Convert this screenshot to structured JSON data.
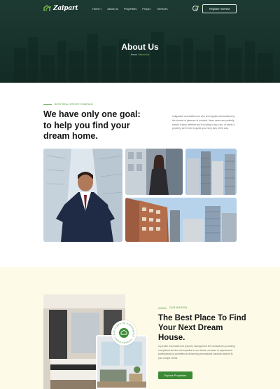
{
  "brand": {
    "name": "Zaipart"
  },
  "nav": [
    {
      "label": "Home",
      "has_dropdown": true
    },
    {
      "label": "About us",
      "has_dropdown": false
    },
    {
      "label": "Properties",
      "has_dropdown": false
    },
    {
      "label": "Props",
      "has_dropdown": true
    },
    {
      "label": "Services",
      "has_dropdown": false
    }
  ],
  "header": {
    "register_label": "Register Interest",
    "bell_icon": "bell-icon"
  },
  "hero": {
    "title": "About Us",
    "breadcrumb_home": "Home",
    "breadcrumb_sep": " / ",
    "breadcrumb_current": "About Us"
  },
  "about": {
    "eyebrow": "BEST REAL ESTATE COMPANY",
    "headline": "We have only one goal: to help you find your dream home.",
    "description": "Indignation and dislike men who are beguiled demoralized by the charms of pleasure of moment, these cases are perfectly simple & easy, whether you're looking to buy, rent, or invest a property, we're here to guide you every step of the way."
  },
  "mission": {
    "eyebrow": "OUR MISSION",
    "title": "The Best Place To Find Your Next Dream House.",
    "description": "A premier real estate and property management firm dedicated to providing exceptional service and expertise to our clients. our team of experienced professionals is committed to delivering personalized solutions tailored to your unique needs.",
    "button_label": "Explore Properties",
    "badge_text": "25 YEARS OF EXPERIENCE • PROFESSIONAL REALTORS •"
  },
  "colors": {
    "hero_bg": "#1d3a33",
    "accent": "#4e9a3a",
    "button": "#3d8a36",
    "mission_bg": "#fdfbe8"
  }
}
